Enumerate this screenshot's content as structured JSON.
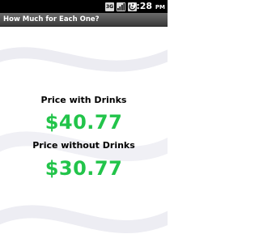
{
  "status_bar": {
    "time": "9:28",
    "time_suffix": "PM",
    "icons": [
      "network-3g-icon",
      "signal-strength-icon",
      "battery-icon"
    ],
    "network_label": "3G"
  },
  "title_bar": {
    "title": "How Much for Each One?"
  },
  "result": {
    "with_drinks_label": "Price with Drinks",
    "with_drinks_value": "$40.77",
    "without_drinks_label": "Price without Drinks",
    "without_drinks_value": "$30.77"
  },
  "colors": {
    "price": "#22c44a",
    "title_bar": "#4a4a4a",
    "status_bar": "#000000"
  }
}
